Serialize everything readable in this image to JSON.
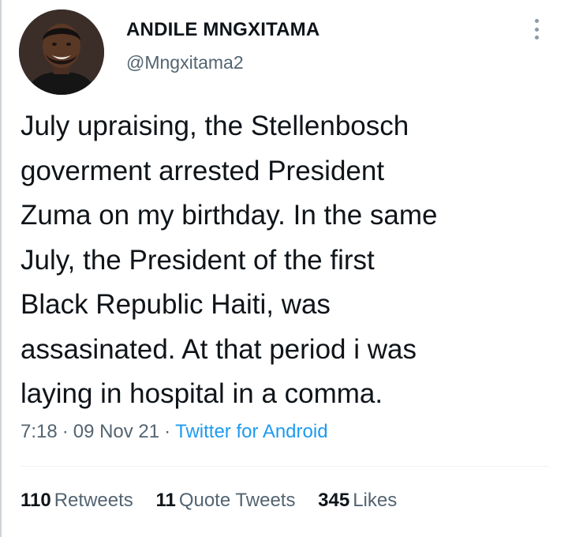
{
  "author": {
    "name": "ANDILE MNGXITAMA",
    "handle": "@Mngxitama2",
    "avatar_icon": "profile-photo"
  },
  "tweet": {
    "text": "July upraising,  the Stellenbosch\ngoverment arrested President\nZuma on my birthday. In the same\nJuly, the President of the first\nBlack Republic Haiti, was\nassasinated. At that period i was\nlaying in hospital in a comma."
  },
  "meta": {
    "time": "7:18",
    "separator": "·",
    "date": "09 Nov 21",
    "source": "Twitter for Android"
  },
  "stats": {
    "retweets_count": "110",
    "retweets_label": "Retweets",
    "quotes_count": "11",
    "quotes_label": "Quote Tweets",
    "likes_count": "345",
    "likes_label": "Likes"
  },
  "colors": {
    "text": "#0f1419",
    "secondary": "#536471",
    "link": "#1d9bf0",
    "divider": "#eff3f4"
  }
}
